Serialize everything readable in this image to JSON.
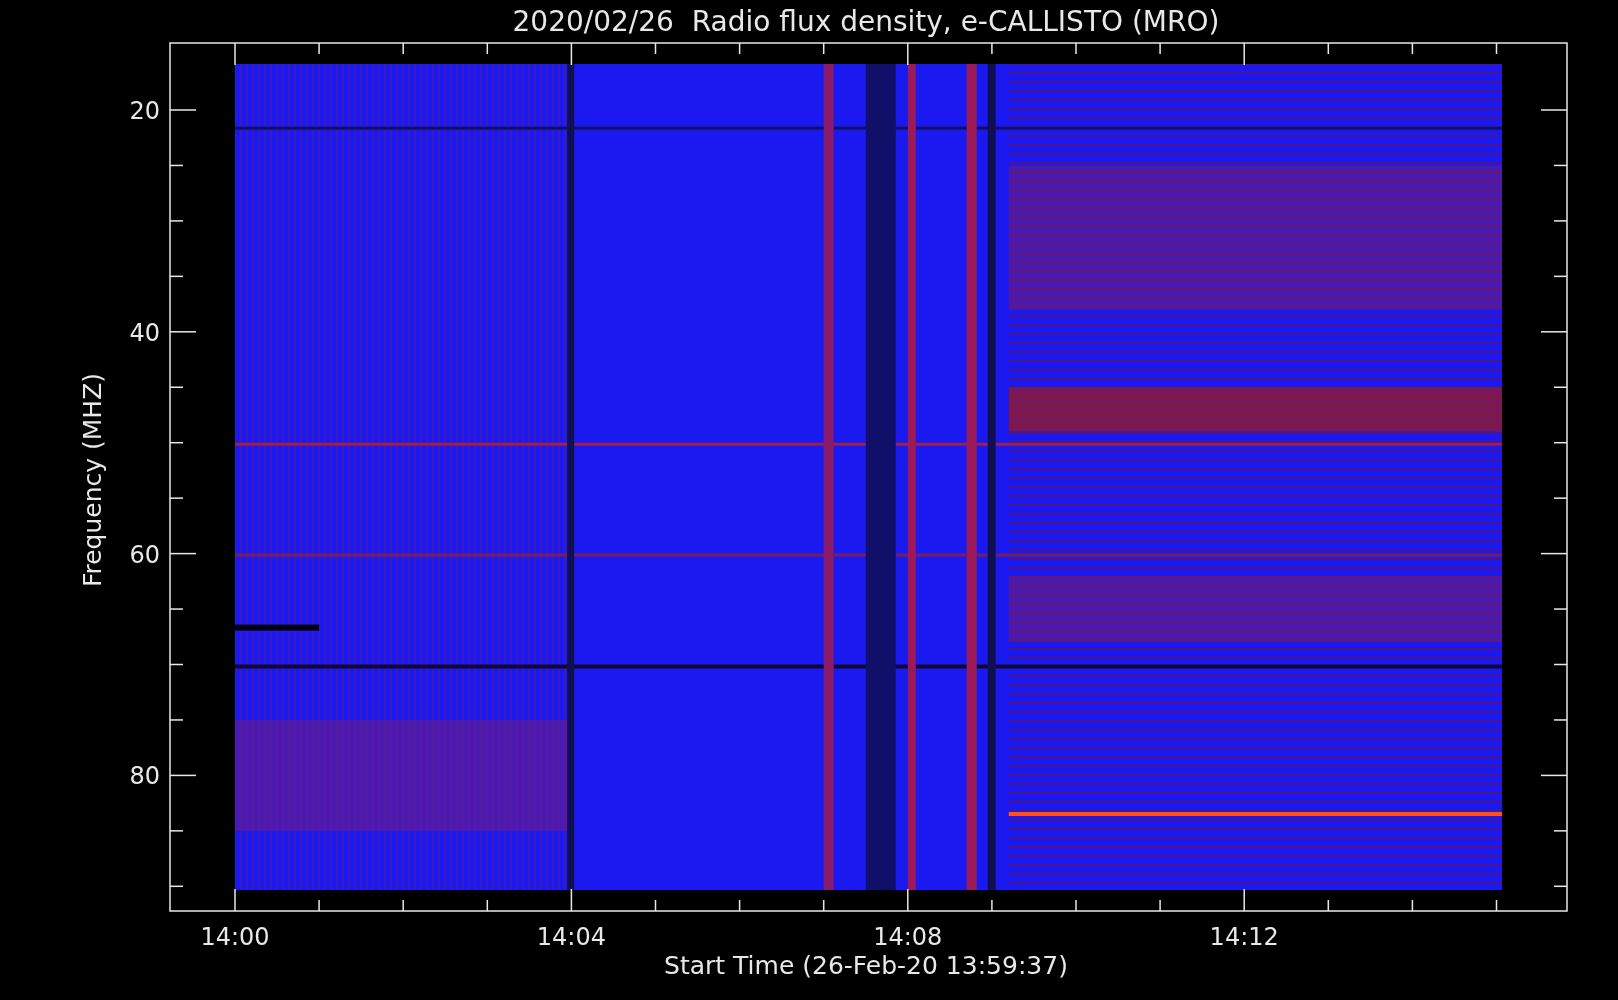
{
  "title": "2020/02/26  Radio flux density, e-CALLISTO (MRO)",
  "y_axis": {
    "label": "Frequency (MHZ)",
    "tick_labels": [
      "20",
      "40",
      "60",
      "80"
    ]
  },
  "x_axis": {
    "label": "Start Time (26-Feb-20 13:59:37)",
    "tick_labels": [
      "14:00",
      "14:04",
      "14:08",
      "14:12"
    ]
  }
}
